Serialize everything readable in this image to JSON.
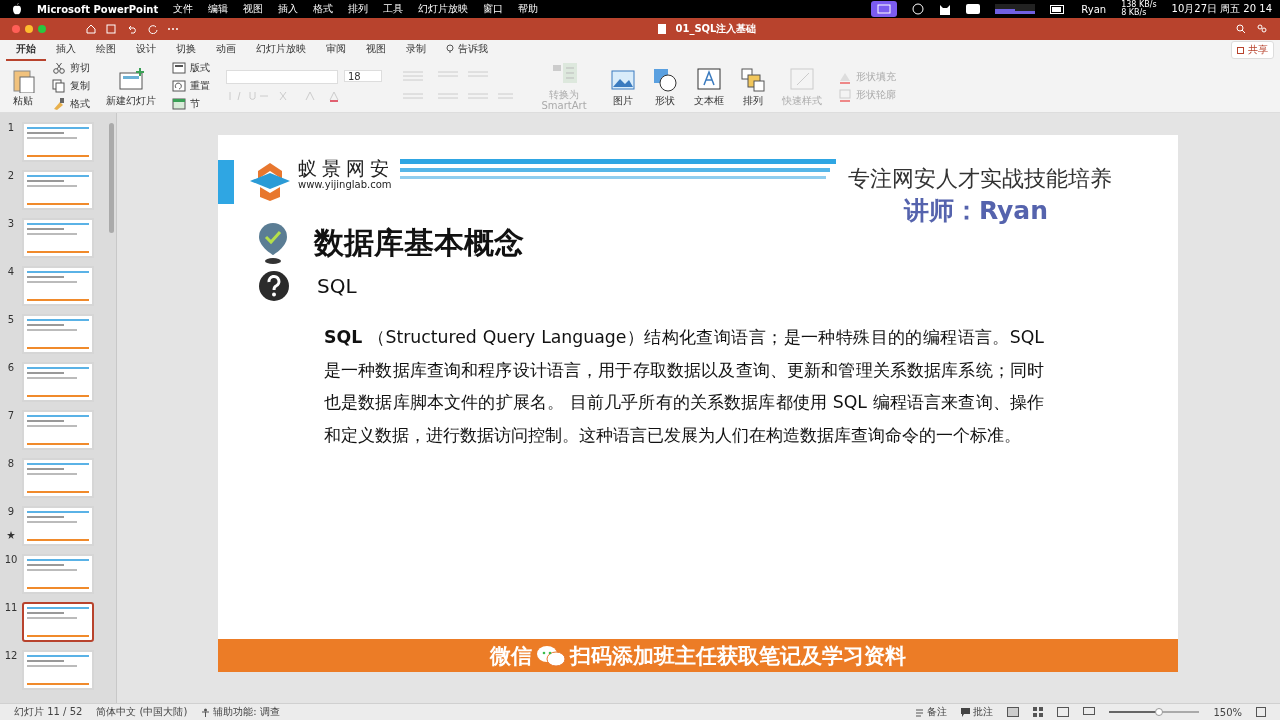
{
  "menubar": {
    "app": "Microsoft PowerPoint",
    "items": [
      "文件",
      "编辑",
      "视图",
      "插入",
      "格式",
      "排列",
      "工具",
      "幻灯片放映",
      "窗口",
      "帮助"
    ],
    "user": "Ryan",
    "net_up": "138 KB/s",
    "net_down": "8 KB/s",
    "clock": "10月27日 周五  20 14"
  },
  "window": {
    "title": "01_SQL注入基础"
  },
  "tabs": [
    {
      "label": "开始",
      "selected": true
    },
    {
      "label": "插入",
      "selected": false
    },
    {
      "label": "绘图",
      "selected": false
    },
    {
      "label": "设计",
      "selected": false
    },
    {
      "label": "切换",
      "selected": false
    },
    {
      "label": "动画",
      "selected": false
    },
    {
      "label": "幻灯片放映",
      "selected": false
    },
    {
      "label": "审阅",
      "selected": false
    },
    {
      "label": "视图",
      "selected": false
    },
    {
      "label": "录制",
      "selected": false
    }
  ],
  "tell_me": "告诉我",
  "share": "共享",
  "ribbon": [
    {
      "kind": "large",
      "label": "粘贴",
      "disabled": false
    },
    {
      "kind": "stack",
      "items": [
        {
          "label": "剪切",
          "disabled": false
        },
        {
          "label": "复制",
          "disabled": false
        },
        {
          "label": "格式",
          "disabled": false
        }
      ]
    },
    {
      "kind": "large",
      "label": "新建幻灯片",
      "disabled": false
    },
    {
      "kind": "stack",
      "items": [
        {
          "label": "版式",
          "disabled": false
        },
        {
          "label": "重置",
          "disabled": false
        },
        {
          "label": "节",
          "disabled": false
        }
      ]
    },
    {
      "kind": "font",
      "size": "18"
    },
    {
      "kind": "large",
      "label": "转换为 SmartArt",
      "disabled": true
    },
    {
      "kind": "large",
      "label": "图片",
      "disabled": false
    },
    {
      "kind": "large",
      "label": "形状",
      "disabled": false
    },
    {
      "kind": "large",
      "label": "文本框",
      "disabled": false
    },
    {
      "kind": "large",
      "label": "排列",
      "disabled": false
    },
    {
      "kind": "large",
      "label": "快速样式",
      "disabled": true
    },
    {
      "kind": "stack",
      "items": [
        {
          "label": "形状填充",
          "disabled": true
        },
        {
          "label": "形状轮廓",
          "disabled": true
        }
      ]
    }
  ],
  "slides": [
    {
      "number": "1",
      "selected": false,
      "starred": false
    },
    {
      "number": "2",
      "selected": false,
      "starred": false
    },
    {
      "number": "3",
      "selected": false,
      "starred": false
    },
    {
      "number": "4",
      "selected": false,
      "starred": false
    },
    {
      "number": "5",
      "selected": false,
      "starred": false
    },
    {
      "number": "6",
      "selected": false,
      "starred": false
    },
    {
      "number": "7",
      "selected": false,
      "starred": false
    },
    {
      "number": "8",
      "selected": false,
      "starred": false
    },
    {
      "number": "9",
      "selected": false,
      "starred": true
    },
    {
      "number": "10",
      "selected": false,
      "starred": false
    },
    {
      "number": "11",
      "selected": true,
      "starred": false
    },
    {
      "number": "12",
      "selected": false,
      "starred": false
    }
  ],
  "slide": {
    "logo_name": "蚁景网安",
    "logo_url": "www.yijinglab.com",
    "tagline": "专注网安人才实战技能培养",
    "lecturer": "讲师：Ryan",
    "heading": "数据库基本概念",
    "subheading": "SQL",
    "paragraph": "**SQL** （Structured Query Language）结构化查询语言；是一种特殊目的的编程语言。SQL是一种数据库查询和程序设计语言，用于存取数据以及查询、更新和管理关系数据库系统；同时也是数据库脚本文件的扩展名。 目前几乎所有的关系数据库都使用 SQL 编程语言来查询、操作和定义数据，进行数据访问控制。这种语言已发展为人们在构造数据库查询命令的一个标准。"
  },
  "banner": {
    "wechat": "微信",
    "text": "扫码添加班主任获取笔记及学习资料"
  },
  "status_bar": {
    "slide_count": "幻灯片 11 / 52",
    "language": "简体中文 (中国大陆)",
    "accessibility": "辅助功能: 调查",
    "notes": "备注",
    "comments": "批注",
    "zoom": "150%",
    "zoom_slider": {
      "level": 0.55
    }
  }
}
